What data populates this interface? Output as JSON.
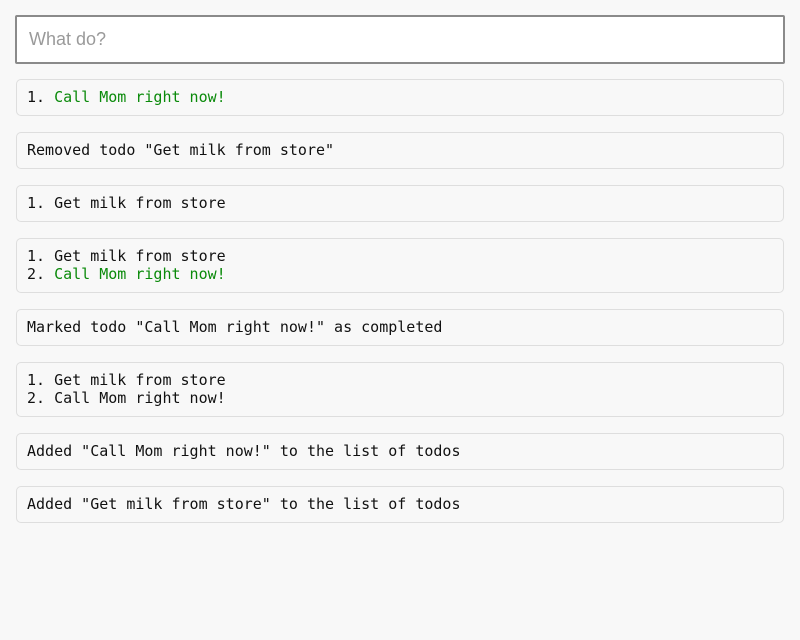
{
  "input": {
    "placeholder": "What do?",
    "value": ""
  },
  "colors": {
    "completed_text": "#0a8a0a",
    "normal_text": "#111111",
    "background": "#f8f8f8",
    "entry_border": "#dedede"
  },
  "log": [
    {
      "type": "list",
      "items": [
        {
          "num": "1. ",
          "text": "Call Mom right now!",
          "completed": true
        }
      ]
    },
    {
      "type": "message",
      "text": "Removed todo \"Get milk from store\""
    },
    {
      "type": "list",
      "items": [
        {
          "num": "1. ",
          "text": "Get milk from store",
          "completed": false
        }
      ]
    },
    {
      "type": "list",
      "items": [
        {
          "num": "1. ",
          "text": "Get milk from store",
          "completed": false
        },
        {
          "num": "2. ",
          "text": "Call Mom right now!",
          "completed": true
        }
      ]
    },
    {
      "type": "message",
      "text": "Marked todo \"Call Mom right now!\" as completed"
    },
    {
      "type": "list",
      "items": [
        {
          "num": "1. ",
          "text": "Get milk from store",
          "completed": false
        },
        {
          "num": "2. ",
          "text": "Call Mom right now!",
          "completed": false
        }
      ]
    },
    {
      "type": "message",
      "text": "Added \"Call Mom right now!\" to the list of todos"
    },
    {
      "type": "message",
      "text": "Added \"Get milk from store\" to the list of todos"
    }
  ]
}
